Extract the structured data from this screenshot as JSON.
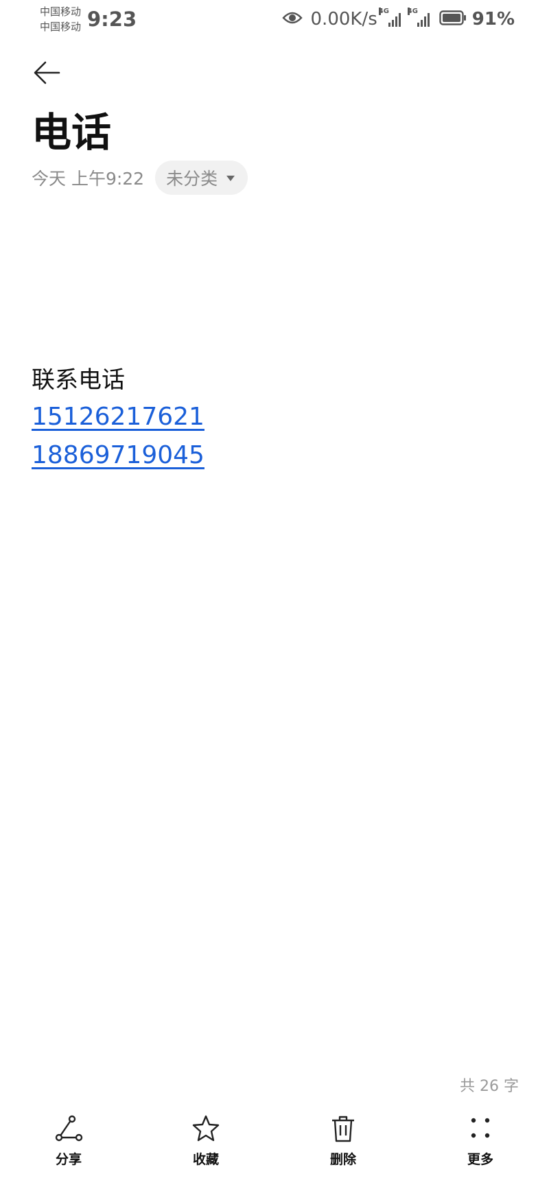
{
  "status_bar": {
    "carriers": [
      "中国移动",
      "中国移动"
    ],
    "time": "9:23",
    "net_speed": "0.00K/s",
    "signal_tags": [
      "4G",
      "4G"
    ],
    "battery_percent": "91%",
    "icons": [
      "eye-icon",
      "signal-icon",
      "battery-icon"
    ]
  },
  "header": {
    "back_icon": "arrow-left-icon",
    "title": "电话",
    "date": "今天 上午9:22",
    "category": "未分类"
  },
  "note": {
    "heading": "联系电话",
    "phones": [
      "15126217621",
      "18869719045"
    ]
  },
  "footer": {
    "word_count": "共 26 字"
  },
  "toolbar": {
    "share": "分享",
    "favorite": "收藏",
    "delete": "删除",
    "more": "更多"
  },
  "colors": {
    "link": "#1a5fd9",
    "chip_bg": "#f1f1f1",
    "muted": "#8a8a8a"
  }
}
